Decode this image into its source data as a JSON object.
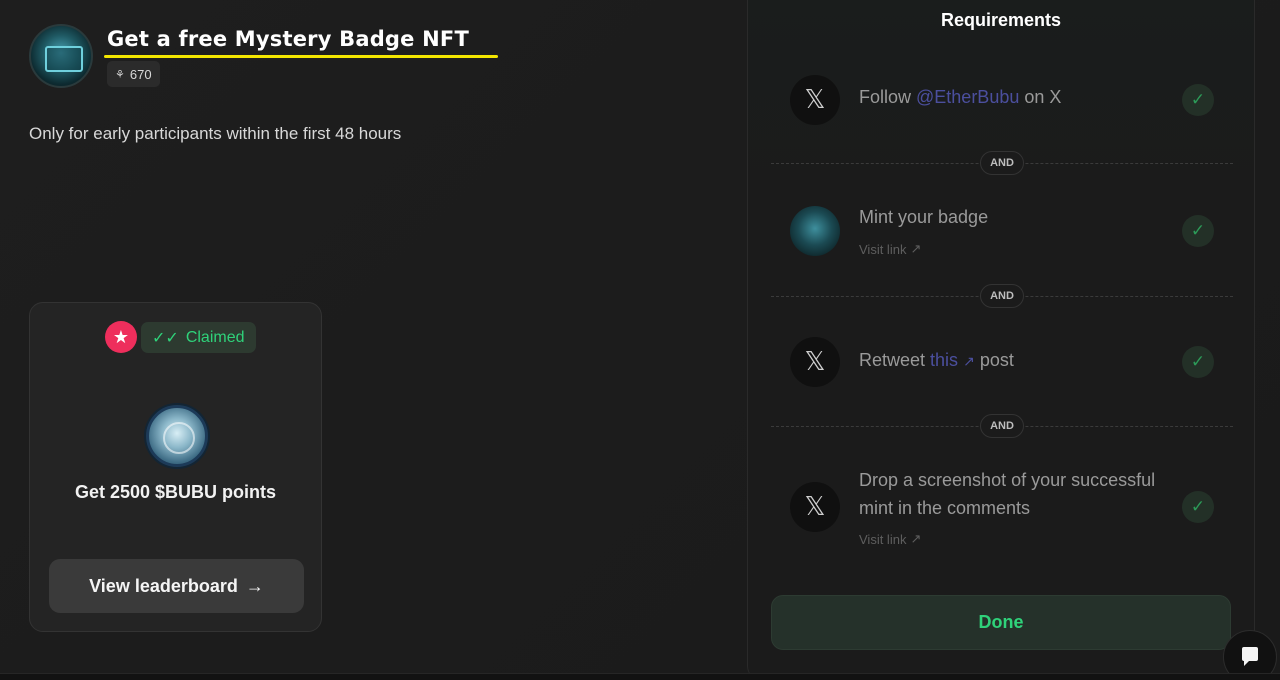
{
  "quest": {
    "title": "Get a free Mystery Badge NFT",
    "participants": "670",
    "participants_icon": "users-icon",
    "description": "Only for early participants within the first 48 hours"
  },
  "reward": {
    "status": "Claimed",
    "status_color": "#2fd27a",
    "badge_color": "#ee2e5c",
    "title": "Get 2500 $BUBU points",
    "button_label": "View leaderboard",
    "button_icon": "arrow-right-icon"
  },
  "requirements": {
    "title": "Requirements",
    "connector": "AND",
    "items": [
      {
        "icon": "x-logo-icon",
        "prefix": "Follow ",
        "link": "@EtherBubu",
        "suffix": " on X",
        "completed": true
      },
      {
        "icon": "badge-image-icon",
        "text": "Mint your badge",
        "visit": "Visit link",
        "completed": true
      },
      {
        "icon": "x-logo-icon",
        "prefix": "Retweet ",
        "link": "this",
        "suffix": " post",
        "completed": true
      },
      {
        "icon": "x-logo-icon",
        "line1": "Drop a screenshot of your successful",
        "line2": "mint in the comments",
        "visit": "Visit link",
        "completed": true
      }
    ],
    "done_label": "Done"
  },
  "chat": {
    "icon": "chat-bubble-icon"
  }
}
